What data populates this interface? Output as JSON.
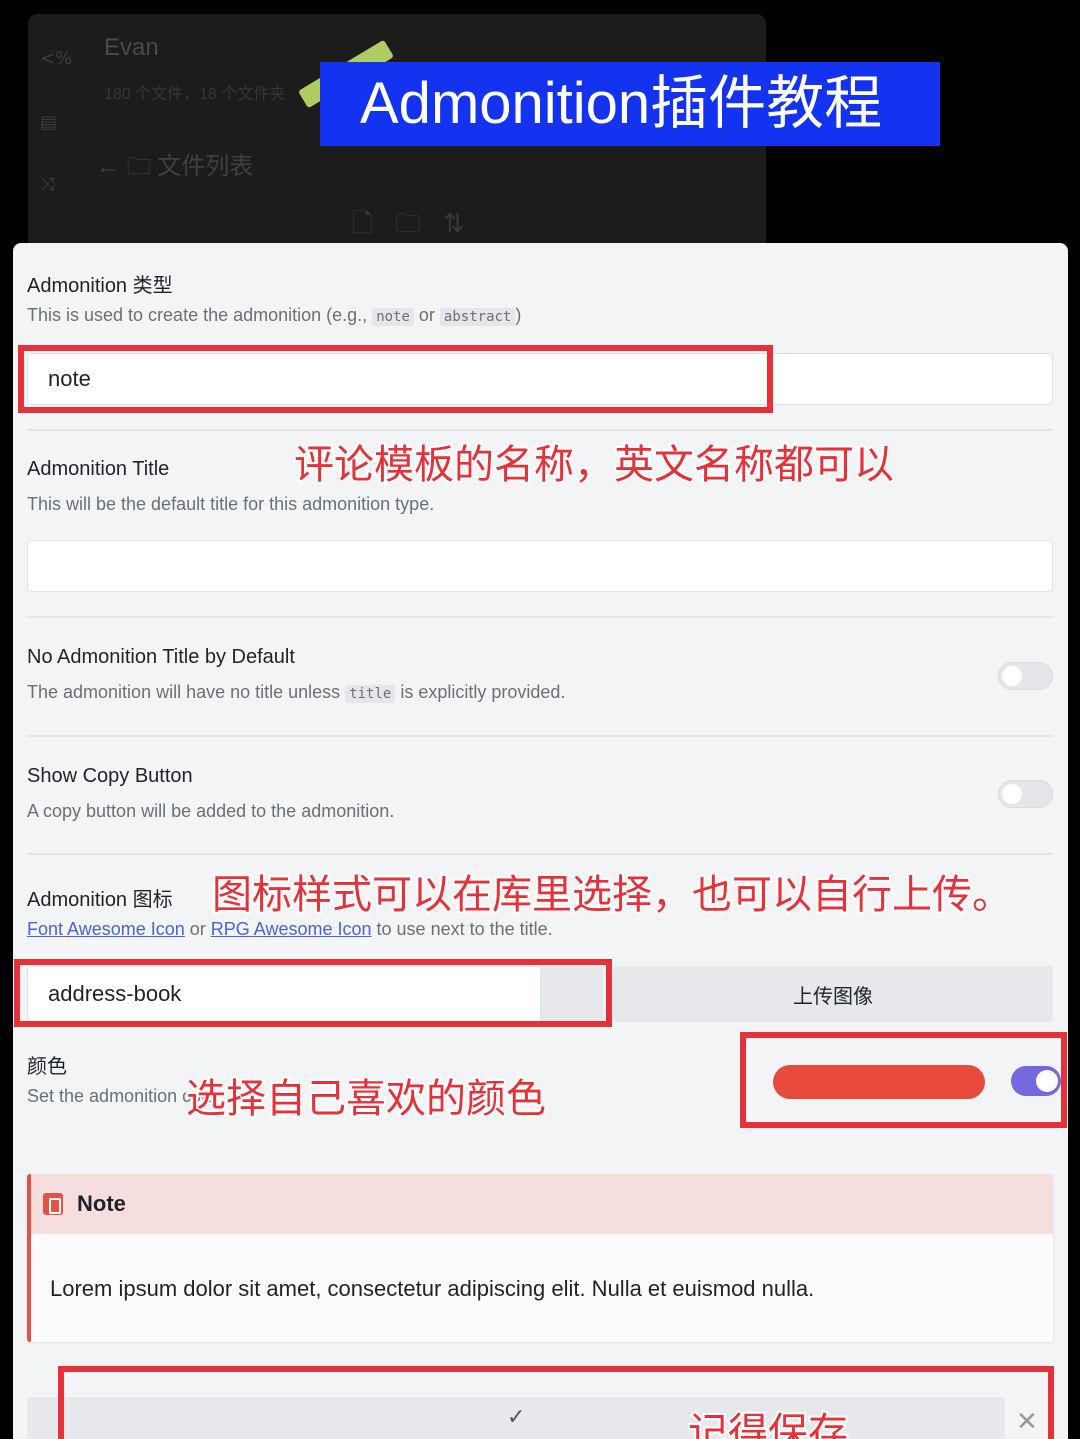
{
  "background_app": {
    "user_name": "Evan",
    "stats": "180 个文件，18 个文件夹",
    "nav_title": "文件列表",
    "rail_icons": [
      "code-icon",
      "layout-icon",
      "shuffle-icon"
    ],
    "tool_icons": [
      "new-file-icon",
      "new-folder-icon",
      "sort-icon"
    ]
  },
  "banner": {
    "title": "Admonition插件教程"
  },
  "settings": {
    "type": {
      "title": "Admonition 类型",
      "desc_prefix": "This is used to create the admonition (e.g., ",
      "code1": "note",
      "desc_or": " or ",
      "code2": "abstract",
      "desc_suffix": ")",
      "value": "note"
    },
    "admon_title": {
      "title": "Admonition Title",
      "desc": "This will be the default title for this admonition type.",
      "value": ""
    },
    "no_title": {
      "title": "No Admonition Title by Default",
      "desc_prefix": "The admonition will have no title unless ",
      "code": "title",
      "desc_suffix": " is explicitly provided.",
      "enabled": false
    },
    "copy_button": {
      "title": "Show Copy Button",
      "desc": "A copy button will be added to the admonition.",
      "enabled": false
    },
    "icon": {
      "title": "Admonition 图标",
      "link1": "Font Awesome Icon",
      "or_text": " or ",
      "link2": "RPG Awesome Icon",
      "desc_suffix": " to use next to the title.",
      "value": "address-book",
      "upload_label": "上传图像"
    },
    "color": {
      "title": "颜色",
      "desc": "Set the admonition color.",
      "value": "#e84b3c",
      "enabled": true
    }
  },
  "preview": {
    "title": "Note",
    "icon": "address-book-icon",
    "body": "Lorem ipsum dolor sit amet, consectetur adipiscing elit. Nulla et euismod nulla."
  },
  "footer": {
    "confirm_glyph": "✓",
    "close_glyph": "✕"
  },
  "annotations": {
    "type_note": "评论模板的名称，英文名称都可以",
    "icon_note": "图标样式可以在库里选择，也可以自行上传。",
    "color_note": "选择自己喜欢的颜色",
    "save_note": "记得保存"
  },
  "colors": {
    "accent": "#7569e0",
    "annotation_red": "#e5323a",
    "banner_blue": "#1433f0"
  }
}
